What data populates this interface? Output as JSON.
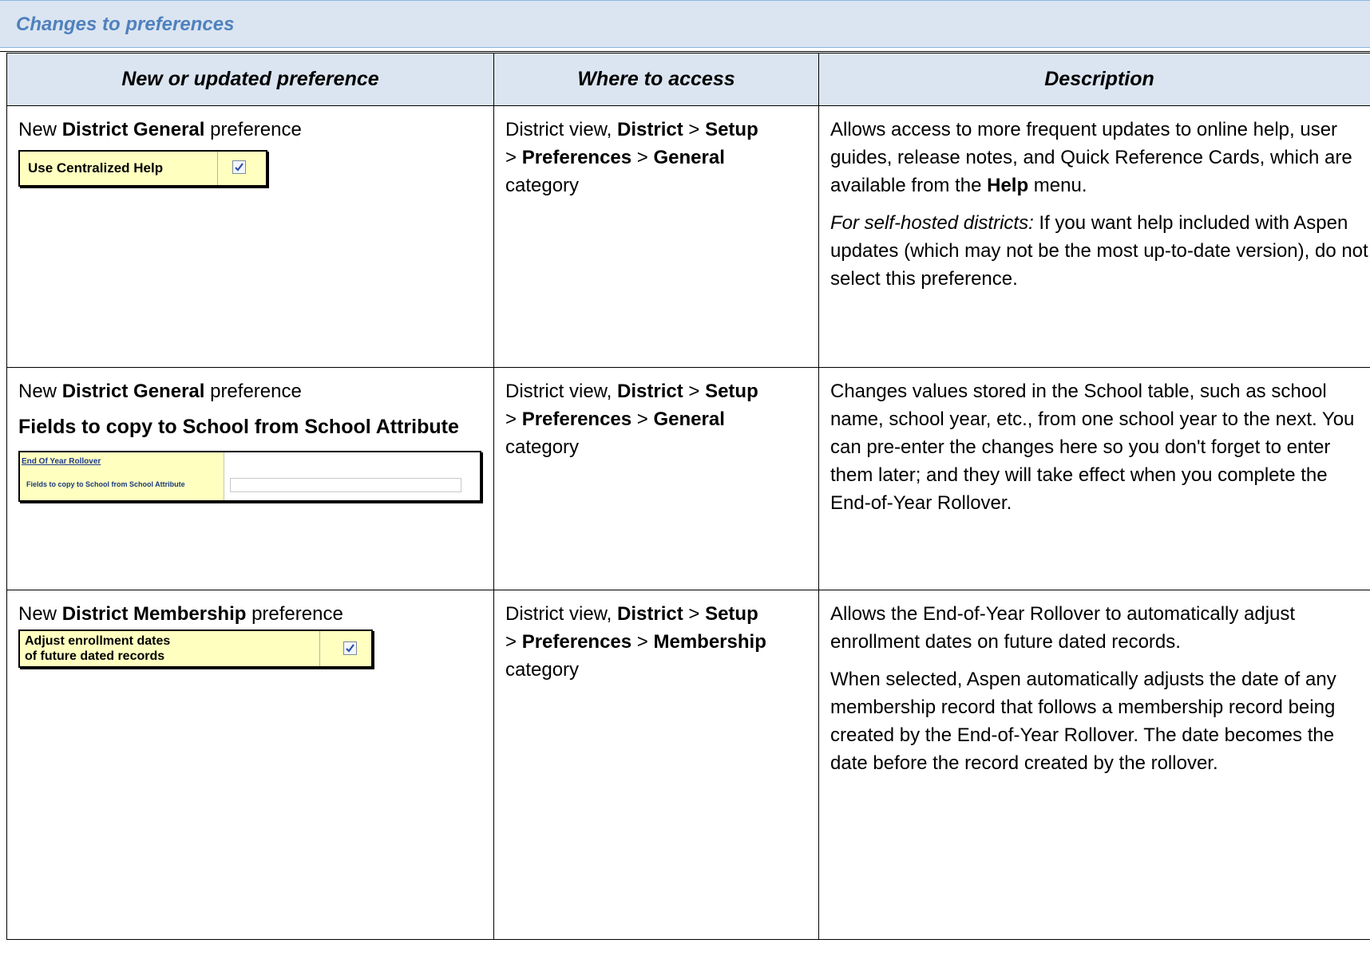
{
  "banner": {
    "title": "Changes to preferences"
  },
  "table": {
    "headers": [
      "New or updated preference",
      "Where to access",
      "Description"
    ],
    "rows": [
      {
        "col1": {
          "prefix": "New ",
          "bold": "District General",
          "suffix": " preference"
        },
        "widget": {
          "label": "Use Centralized Help",
          "checked": true
        },
        "col2": {
          "t1": "District view, ",
          "b1": "District",
          "t2": " > ",
          "b2": "Setup",
          "t3": "> ",
          "b3": "Preferences",
          "t4": " > ",
          "b4": "General",
          "t5": "category"
        },
        "col3": {
          "p1": "Allows access to more frequent updates to online help, user guides, release notes, and Quick Reference Cards, which are available from the ",
          "p1_bold": "Help",
          "p1_end": " menu.",
          "p2_italic": "For self-hosted districts:",
          "p2": " If you want help included with Aspen updates (which may not be the most up-to-date version), do not select this preference."
        }
      },
      {
        "col1": {
          "prefix": "New ",
          "bold": "District General",
          "suffix": " preference"
        },
        "subheading": "Fields to copy to School from School Attribute",
        "widget": {
          "section": "End Of Year Rollover",
          "field_label": "Fields to copy to School from School Attribute",
          "value": ""
        },
        "col2": {
          "t1": "District view, ",
          "b1": "District",
          "t2": " > ",
          "b2": "Setup",
          "t3": "> ",
          "b3": "Preferences",
          "t4": " > ",
          "b4": "General",
          "t5": "category"
        },
        "col3": {
          "p1": "Changes values stored in the School table, such as school name, school year, etc., from one school year to the next. You can pre-enter the changes here so you don't forget to enter them later; and they will take effect when you complete the End-of-Year Rollover."
        }
      },
      {
        "col1": {
          "prefix": "New ",
          "bold": "District Membership",
          "suffix": " preference"
        },
        "widget": {
          "label_line1": "Adjust enrollment dates",
          "label_line2": "of future dated records",
          "checked": true
        },
        "col2": {
          "t1": "District view, ",
          "b1": "District",
          "t2": " > ",
          "b2": "Setup",
          "t3": "> ",
          "b3": "Preferences",
          "t4": " > ",
          "b4": "Membership",
          "t5": "category"
        },
        "col3": {
          "p1": "Allows the End-of-Year Rollover to automatically adjust enrollment dates on future dated records.",
          "p2": "When selected, Aspen automatically adjusts the date of any membership record that follows a membership record being created by the End-of-Year Rollover. The date becomes the date before the record created by the rollover."
        }
      }
    ]
  }
}
